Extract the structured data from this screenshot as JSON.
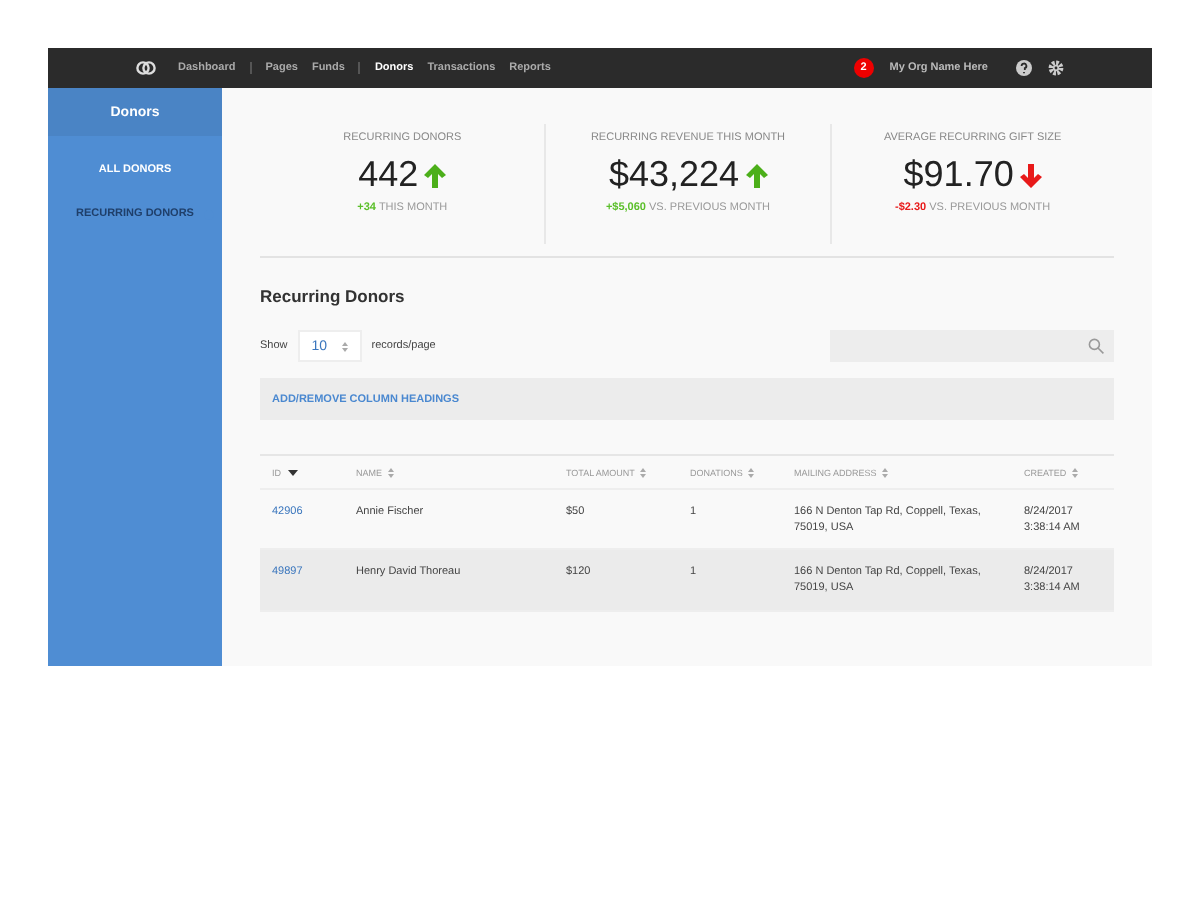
{
  "nav": {
    "groups": [
      [
        {
          "label": "Dashboard",
          "selected": false
        }
      ],
      [
        {
          "label": "Pages",
          "selected": false
        },
        {
          "label": "Funds",
          "selected": false
        }
      ],
      [
        {
          "label": "Donors",
          "selected": true
        },
        {
          "label": "Transactions",
          "selected": false
        },
        {
          "label": "Reports",
          "selected": false
        }
      ]
    ],
    "notification_count": "2",
    "org_name": "My Org Name Here"
  },
  "sidebar": {
    "title": "Donors",
    "items": [
      {
        "label": "ALL DONORS",
        "selected": false
      },
      {
        "label": "RECURRING DONORS",
        "selected": true
      }
    ]
  },
  "stats": [
    {
      "label": "RECURRING DONORS",
      "value": "442",
      "trend_up": true,
      "change": "+34",
      "note": "THIS MONTH"
    },
    {
      "label": "RECURRING REVENUE THIS MONTH",
      "value": "$43,224",
      "trend_up": true,
      "change": "+$5,060",
      "note": "VS. PREVIOUS MONTH"
    },
    {
      "label": "AVERAGE RECURRING GIFT SIZE",
      "value": "$91.70",
      "trend_up": false,
      "change": "-$2.30",
      "note": "VS. PREVIOUS MONTH"
    }
  ],
  "section_title": "Recurring Donors",
  "show_label": "Show",
  "page_size": "10",
  "page_size_suffix": "records/page",
  "column_link": "ADD/REMOVE COLUMN HEADINGS",
  "table": {
    "columns": [
      {
        "label": "ID",
        "sorted": true
      },
      {
        "label": "NAME",
        "sorted": false
      },
      {
        "label": "TOTAL AMOUNT",
        "sorted": false
      },
      {
        "label": "DONATIONS",
        "sorted": false
      },
      {
        "label": "MAILING ADDRESS",
        "sorted": false
      },
      {
        "label": "CREATED",
        "sorted": false
      }
    ],
    "rows": [
      {
        "cells": [
          "42906",
          "Annie Fischer",
          "$50",
          "1",
          "166 N Denton Tap Rd, Coppell, Texas, 75019, USA",
          "8/24/2017 3:38:14 AM"
        ],
        "selected": false
      },
      {
        "cells": [
          "49897",
          "Henry David Thoreau",
          "$120",
          "1",
          "166 N Denton Tap Rd, Coppell, Texas, 75019, USA",
          "8/24/2017 3:38:14 AM"
        ],
        "selected": true
      }
    ]
  }
}
